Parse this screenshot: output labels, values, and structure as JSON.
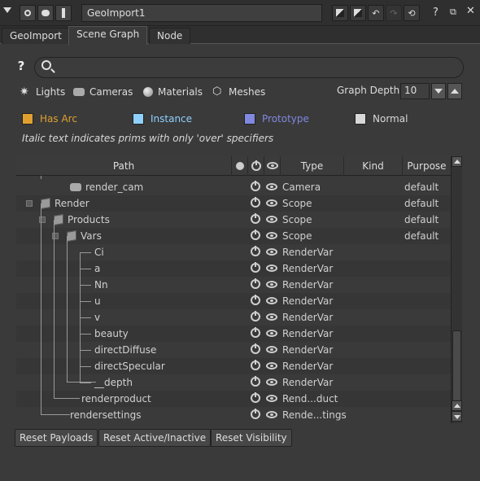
{
  "node": {
    "name": "GeoImport1"
  },
  "tabs": [
    "GeoImport",
    "Scene Graph",
    "Node"
  ],
  "filters": {
    "items": [
      "Lights",
      "Cameras",
      "Materials",
      "Meshes"
    ],
    "graph_depth_label": "Graph Depth",
    "graph_depth_value": "10"
  },
  "legend": [
    {
      "label": "Has Arc",
      "color": "#e0a030"
    },
    {
      "label": "Instance",
      "color": "#8fd0ff"
    },
    {
      "label": "Prototype",
      "color": "#8088e0"
    },
    {
      "label": "Normal",
      "color": "#d8d8d8"
    }
  ],
  "note": "Italic text indicates prims with only 'over' specifiers",
  "table": {
    "columns": [
      "Path",
      "Type",
      "Kind",
      "Purpose"
    ],
    "rows": [
      {
        "name": "render_cam",
        "type": "Camera",
        "purpose": "default",
        "icon": "camera-icon"
      },
      {
        "name": "Render",
        "type": "Scope",
        "purpose": "default",
        "icon": "cube-icon"
      },
      {
        "name": "Products",
        "type": "Scope",
        "purpose": "default",
        "icon": "cube-icon"
      },
      {
        "name": "Vars",
        "type": "Scope",
        "purpose": "default",
        "icon": "cube-icon"
      },
      {
        "name": "Ci",
        "type": "RenderVar",
        "purpose": ""
      },
      {
        "name": "a",
        "type": "RenderVar",
        "purpose": ""
      },
      {
        "name": "Nn",
        "type": "RenderVar",
        "purpose": ""
      },
      {
        "name": "u",
        "type": "RenderVar",
        "purpose": ""
      },
      {
        "name": "v",
        "type": "RenderVar",
        "purpose": ""
      },
      {
        "name": "beauty",
        "type": "RenderVar",
        "purpose": ""
      },
      {
        "name": "directDiffuse",
        "type": "RenderVar",
        "purpose": ""
      },
      {
        "name": "directSpecular",
        "type": "RenderVar",
        "purpose": ""
      },
      {
        "name": "__depth",
        "type": "RenderVar",
        "purpose": ""
      },
      {
        "name": "renderproduct",
        "type": "Rend...duct",
        "purpose": ""
      },
      {
        "name": "rendersettings",
        "type": "Rende...tings",
        "purpose": ""
      }
    ]
  },
  "buttons": {
    "reset_payloads": "Reset Payloads",
    "reset_active": "Reset Active/Inactive",
    "reset_visibility": "Reset Visibility"
  }
}
